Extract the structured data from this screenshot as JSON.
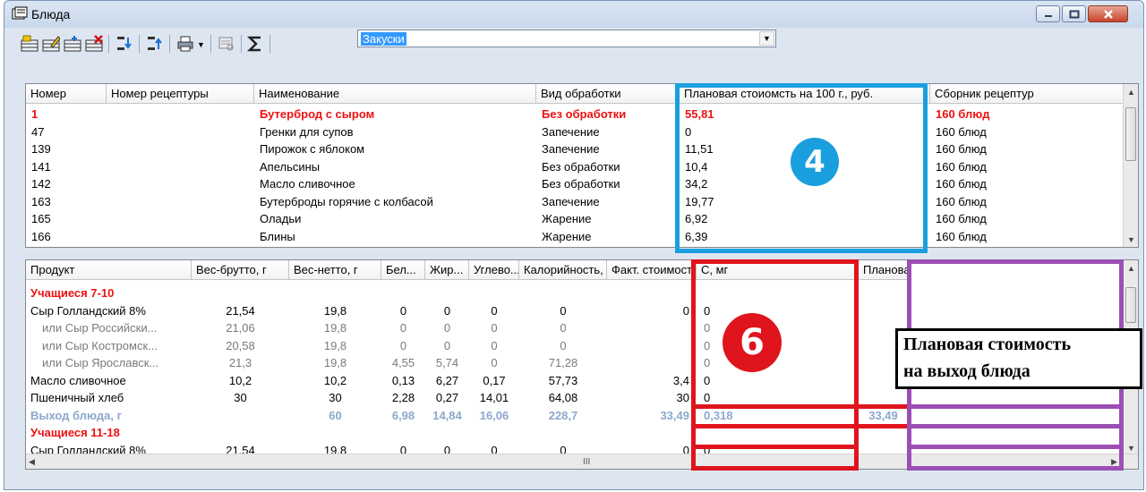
{
  "window": {
    "title": "Блюда",
    "icon": "dishes-app-icon",
    "controls": [
      "minimize-icon",
      "maximize-icon",
      "close-icon"
    ]
  },
  "toolbar": {
    "icons": [
      "add-record-icon",
      "edit-record-icon",
      "copy-record-icon",
      "delete-record-icon",
      "move-down-icon",
      "move-up-icon",
      "print-icon",
      "preview-icon",
      "sum-icon"
    ],
    "filter_value": "Закуски"
  },
  "dishes": {
    "columns": [
      "Номер",
      "Номер рецептуры",
      "Наименование",
      "Вид обработки",
      "Плановая стоиомсть на 100 г., руб.",
      "Сборник рецептур"
    ],
    "rows": [
      {
        "num": "1",
        "recipe": "",
        "name": "Бутерброд с сыром",
        "processing": "Без обработки",
        "cost": "55,81",
        "collection": "160 блюд",
        "selected": true
      },
      {
        "num": "47",
        "recipe": "",
        "name": "Гренки для супов",
        "processing": "Запечение",
        "cost": "0",
        "collection": "160 блюд"
      },
      {
        "num": "139",
        "recipe": "",
        "name": "Пирожок с яблоком",
        "processing": "Запечение",
        "cost": "11,51",
        "collection": "160 блюд"
      },
      {
        "num": "141",
        "recipe": "",
        "name": "Апельсины",
        "processing": "Без обработки",
        "cost": "10,4",
        "collection": "160 блюд"
      },
      {
        "num": "142",
        "recipe": "",
        "name": "Масло сливочное",
        "processing": "Без обработки",
        "cost": "34,2",
        "collection": "160 блюд"
      },
      {
        "num": "163",
        "recipe": "",
        "name": "Бутерброды горячие с колбасой",
        "processing": "Запечение",
        "cost": "19,77",
        "collection": "160 блюд"
      },
      {
        "num": "165",
        "recipe": "",
        "name": "Оладьи",
        "processing": "Жарение",
        "cost": "6,92",
        "collection": "160 блюд"
      },
      {
        "num": "166",
        "recipe": "",
        "name": "Блины",
        "processing": "Жарение",
        "cost": "6,39",
        "collection": "160 блюд"
      }
    ]
  },
  "ingredients": {
    "columns": [
      "Продукт",
      "Вес-брутто, г",
      "Вес-нетто, г",
      "Бел...",
      "Жир...",
      "Углево...",
      "Калорийность, ...",
      "Факт. стоимость, руб.",
      "С, мг",
      "Плановая стоимость на выхо..."
    ],
    "rows": [
      {
        "style": "group",
        "product": "Учащиеся 7-10",
        "brutto": "",
        "netto": "",
        "prot": "",
        "fat": "",
        "carb": "",
        "cal": "",
        "fact": "",
        "c": "",
        "plan": ""
      },
      {
        "style": "normal",
        "product": "Сыр Голландский 8%",
        "brutto": "21,54",
        "netto": "19,8",
        "prot": "0",
        "fat": "0",
        "carb": "0",
        "cal": "0",
        "fact": "0",
        "c": "0",
        "plan": ""
      },
      {
        "style": "alt",
        "product": "или Сыр Российски...",
        "brutto": "21,06",
        "netto": "19,8",
        "prot": "0",
        "fat": "0",
        "carb": "0",
        "cal": "0",
        "fact": "",
        "c": "0",
        "plan": ""
      },
      {
        "style": "alt",
        "product": "или Сыр Костромск...",
        "brutto": "20,58",
        "netto": "19,8",
        "prot": "0",
        "fat": "0",
        "carb": "0",
        "cal": "0",
        "fact": "",
        "c": "0",
        "plan": ""
      },
      {
        "style": "alt",
        "product": "или Сыр Ярославск...",
        "brutto": "21,3",
        "netto": "19,8",
        "prot": "4,55",
        "fat": "5,74",
        "carb": "0",
        "cal": "71,28",
        "fact": "",
        "c": "0",
        "plan": ""
      },
      {
        "style": "normal",
        "product": "Масло сливочное",
        "brutto": "10,2",
        "netto": "10,2",
        "prot": "0,13",
        "fat": "6,27",
        "carb": "0,17",
        "cal": "57,73",
        "fact": "3,4",
        "c": "0",
        "plan": ""
      },
      {
        "style": "normal",
        "product": "Пшеничный хлеб",
        "brutto": "30",
        "netto": "30",
        "prot": "2,28",
        "fat": "0,27",
        "carb": "14,01",
        "cal": "64,08",
        "fact": "30",
        "c": "0",
        "plan": ""
      },
      {
        "style": "total",
        "product": "Выход блюда, г",
        "brutto": "",
        "netto": "60",
        "prot": "6,98",
        "fat": "14,84",
        "carb": "16,06",
        "cal": "228,7",
        "fact": "33,49",
        "c": "0,318",
        "plan": "33,49"
      },
      {
        "style": "group",
        "product": "Учащиеся 11-18",
        "brutto": "",
        "netto": "",
        "prot": "",
        "fat": "",
        "carb": "",
        "cal": "",
        "fact": "",
        "c": "",
        "plan": ""
      },
      {
        "style": "normal",
        "product": "Сыр Голландский 8%",
        "brutto": "21,54",
        "netto": "19,8",
        "prot": "0",
        "fat": "0",
        "carb": "0",
        "cal": "0",
        "fact": "0",
        "c": "0",
        "plan": ""
      }
    ],
    "hscroll_mark": "III"
  },
  "annotations": {
    "badge_4": "4",
    "badge_6": "6",
    "callout_line1": "Плановая стоимость",
    "callout_line2": "на выход блюда",
    "colors": {
      "blue": "#1a9fde",
      "red": "#e0141c",
      "purple": "#9b4fb4",
      "group_text": "#ee1111",
      "total_text": "#8ca8cc"
    }
  }
}
